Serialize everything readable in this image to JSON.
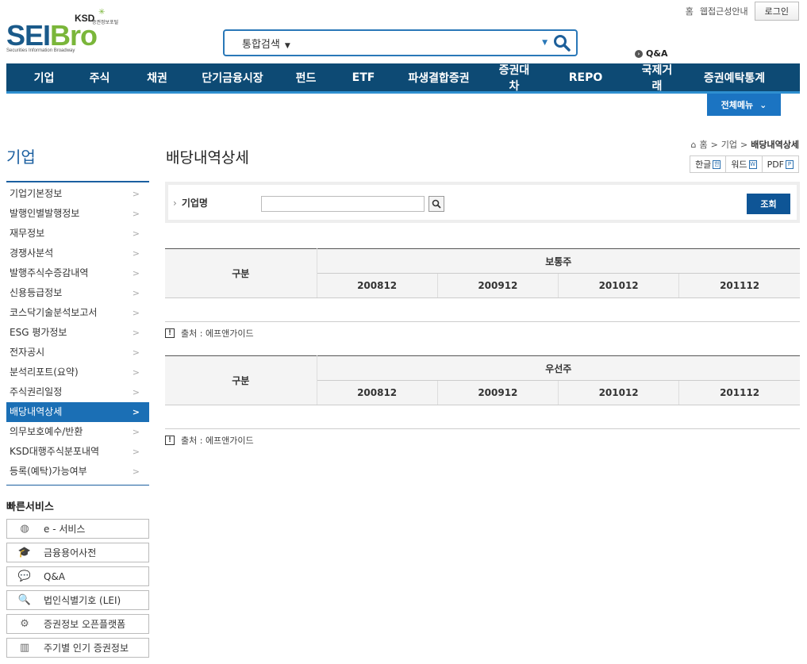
{
  "utility": {
    "home": "홈",
    "accessibility": "웹접근성안내",
    "login": "로그인"
  },
  "logo": {
    "ksd": "KSD",
    "portal": "증권정보포털",
    "main_left": "SEI",
    "main_right": "Bro",
    "sub": "Securities Information Broadway"
  },
  "search": {
    "type": "통합검색",
    "value": ""
  },
  "qa": "Q&A",
  "gnb": [
    "기업",
    "주식",
    "채권",
    "단기금융시장",
    "펀드",
    "ETF",
    "파생결합증권",
    "증권대차",
    "REPO",
    "국제거래",
    "증권예탁통계"
  ],
  "all_menu": "전체메뉴",
  "lnb": {
    "title": "기업",
    "items": [
      "기업기본정보",
      "발행인별발행정보",
      "재무정보",
      "경쟁사분석",
      "발행주식수증감내역",
      "신용등급정보",
      "코스닥기술분석보고서",
      "ESG 평가정보",
      "전자공시",
      "분석리포트(요약)",
      "주식권리일정",
      "배당내역상세",
      "의무보호예수/반환",
      "KSD대행주식분포내역",
      "등록(예탁)가능여부"
    ],
    "active_index": 11,
    "arrow": ">"
  },
  "quick": {
    "title": "빠른서비스",
    "items": [
      {
        "label": "e - 서비스",
        "icon": "globe-icon"
      },
      {
        "label": "금융용어사전",
        "icon": "graduation-cap-icon"
      },
      {
        "label": "Q&A",
        "icon": "chat-bubble-icon"
      },
      {
        "label": "법인식별기호 (LEI)",
        "icon": "document-search-icon"
      },
      {
        "label": "증권정보 오픈플랫폼",
        "icon": "api-gear-icon"
      },
      {
        "label": "주기별 인기 증권정보",
        "icon": "bar-chart-icon"
      }
    ]
  },
  "breadcrumb": {
    "home": "홈",
    "sep": ">",
    "level1": "기업",
    "current": "배당내역상세"
  },
  "page_title": "배당내역상세",
  "doc_buttons": [
    "한글",
    "워드",
    "PDF"
  ],
  "search_form": {
    "label": "기업명",
    "value": "",
    "button": "조회"
  },
  "table1": {
    "col_header": "구분",
    "group": "보통주",
    "years": [
      "200812",
      "200912",
      "201012",
      "201112"
    ]
  },
  "table2": {
    "col_header": "구분",
    "group": "우선주",
    "years": [
      "200812",
      "200912",
      "201012",
      "201112"
    ]
  },
  "source": {
    "text": "출처 : 에프앤가이드",
    "icon": "exclamation-icon"
  }
}
